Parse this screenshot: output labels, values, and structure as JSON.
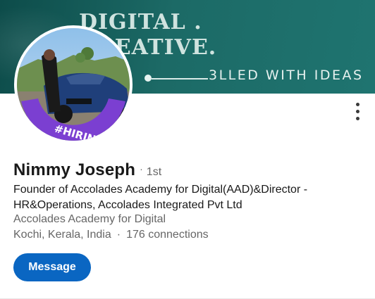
{
  "banner": {
    "line1": "DIGITAL .",
    "line2": "CREATIVE.",
    "tagline": "3LLED WITH IDEAS"
  },
  "avatar": {
    "frame_text": "#HIRING",
    "frame_color": "#7b3fd1"
  },
  "profile": {
    "name": "Nimmy Joseph",
    "separator": "·",
    "degree": "1st",
    "headline": "Founder of Accolades Academy for Digital(AAD)&Director - HR&Operations, Accolades Integrated Pvt Ltd",
    "company": "Accolades Academy for Digital",
    "location": "Kochi, Kerala, India",
    "dot": "·",
    "connections": "176 connections"
  },
  "actions": {
    "message_label": "Message",
    "more_icon": "more-vertical-icon"
  },
  "colors": {
    "accent": "#0a66c2",
    "banner": "#1c6a66"
  }
}
